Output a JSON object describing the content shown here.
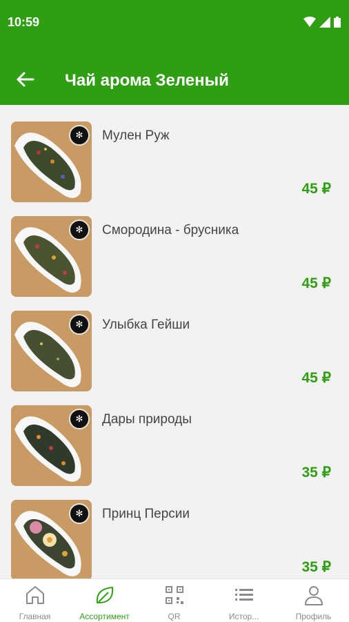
{
  "status": {
    "time": "10:59"
  },
  "header": {
    "title": "Чай арома Зеленый",
    "accent": "#2f9e12"
  },
  "products": [
    {
      "name": "Мулен Руж",
      "price": "45 ₽"
    },
    {
      "name": "Смородина - брусника",
      "price": "45 ₽"
    },
    {
      "name": "Улыбка Гейши",
      "price": "45 ₽"
    },
    {
      "name": "Дары природы",
      "price": "35 ₽"
    },
    {
      "name": "Принц Персии",
      "price": "35 ₽"
    }
  ],
  "nav": [
    {
      "label": "Главная",
      "icon": "home-icon"
    },
    {
      "label": "Ассортимент",
      "icon": "leaf-icon",
      "active": true
    },
    {
      "label": "QR",
      "icon": "qr-icon"
    },
    {
      "label": "Истор...",
      "icon": "list-icon"
    },
    {
      "label": "Профиль",
      "icon": "person-icon"
    }
  ]
}
